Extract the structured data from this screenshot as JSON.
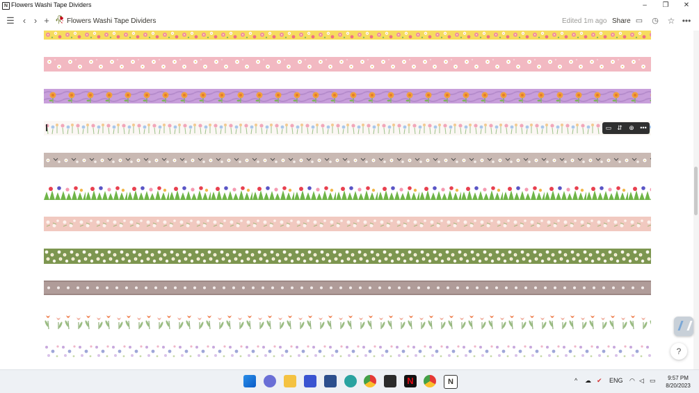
{
  "window": {
    "title": "Flowers Washi Tape Dividers",
    "controls": [
      "minimize-icon",
      "restore-icon",
      "close-icon"
    ]
  },
  "toolbar": {
    "page_title": "Flowers Washi Tape Dividers",
    "edited": "Edited 1m ago",
    "share": "Share",
    "icons": [
      "menu-icon",
      "back-icon",
      "forward-icon",
      "new-page-icon",
      "comments-icon",
      "updates-icon",
      "favorite-icon",
      "more-icon"
    ]
  },
  "tapes": [
    {
      "name": "yellow-flower-tape",
      "bg": "#f6dc5f"
    },
    {
      "name": "pink-daisy-tape",
      "bg": "#f2b9c2"
    },
    {
      "name": "purple-orange-flower-tape",
      "bg": "#c89fdb"
    },
    {
      "name": "white-pastel-flower-tape",
      "bg": "#fbf7f4"
    },
    {
      "name": "taupe-daisy-tape",
      "bg": "#c9b9b3"
    },
    {
      "name": "tulip-grass-tape",
      "bg": "#ffffff"
    },
    {
      "name": "peach-blossom-tape",
      "bg": "#f1c9c0"
    },
    {
      "name": "green-daisy-field-tape",
      "bg": "#7d9650"
    },
    {
      "name": "mauve-dot-flower-tape",
      "bg": "#b09c99"
    },
    {
      "name": "orange-tulip-tape",
      "bg": "#ffffff"
    },
    {
      "name": "lilac-scatter-flower-tape",
      "bg": "#ffffff"
    }
  ],
  "block_toolbar": [
    "comment-icon",
    "drag-icon",
    "add-icon",
    "more-options-icon"
  ],
  "help": "?",
  "taskbar": {
    "apps": [
      "windows-start-icon",
      "teams-chat-icon",
      "file-explorer-icon",
      "app-icon",
      "store-icon",
      "edge-icon",
      "chrome-icon",
      "sticky-notes-icon",
      "netflix-icon",
      "chrome-icon-2",
      "notion-icon"
    ],
    "language": "ENG",
    "time": "9:57 PM",
    "date": "8/20/2023"
  }
}
